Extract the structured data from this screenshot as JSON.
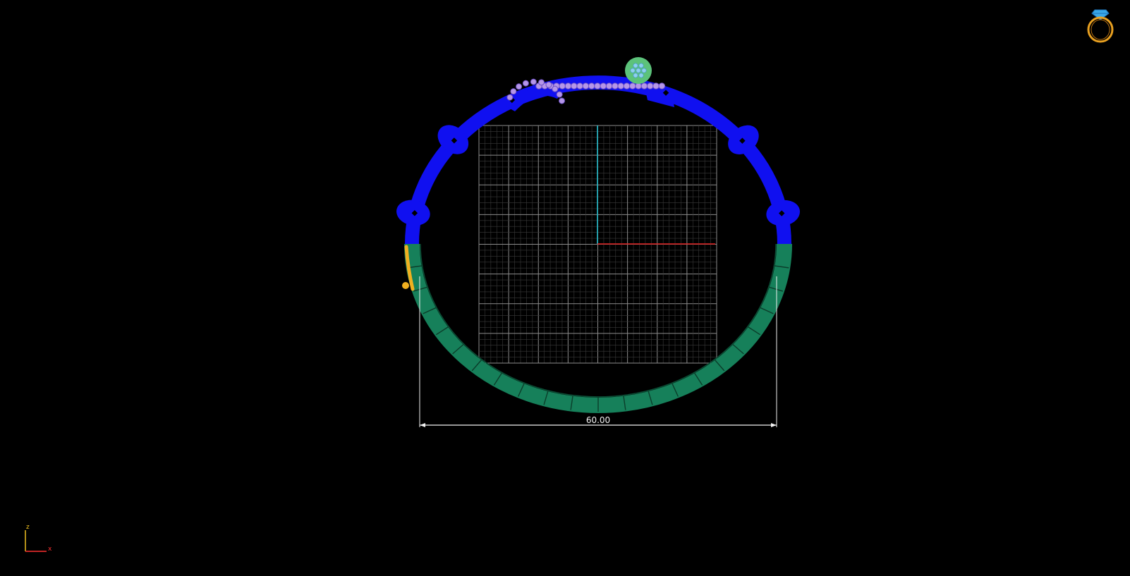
{
  "viewport": {
    "background": "#000000",
    "view": "front",
    "dimension": {
      "label": "60.00",
      "color": "#f2f2f2"
    },
    "axis_indicator": {
      "vertical_label": "z",
      "horizontal_label": "x",
      "vertical_color": "#f0c020",
      "horizontal_color": "#ff3030"
    },
    "colors": {
      "upper_band": "#1010f0",
      "lower_band": "#16805a",
      "gallery_stones": "#b596e8",
      "center_stone": "#5cc27a",
      "clasp": "#f0b020",
      "grid": "#7a7a7a",
      "axis_vertical": "#18b8c8",
      "axis_horizontal": "#e02020"
    },
    "icons": {
      "ring_view": "ring-icon"
    }
  }
}
